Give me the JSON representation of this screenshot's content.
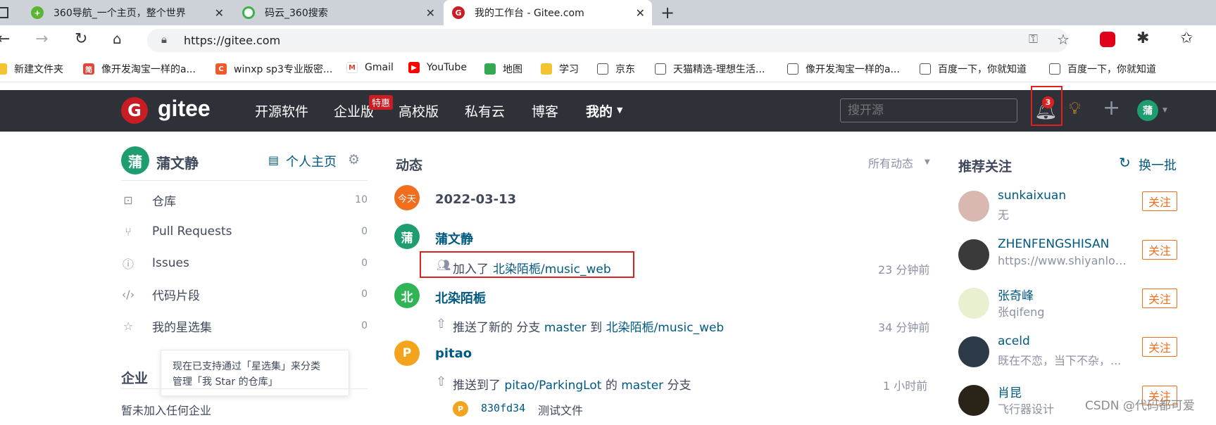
{
  "browser": {
    "tabs": [
      {
        "title": "360导航_一个主页，整个世界",
        "icon": "360-plus-icon"
      },
      {
        "title": "码云_360搜索",
        "icon": "360-search-icon"
      },
      {
        "title": "我的工作台 - Gitee.com",
        "icon": "gitee-icon"
      }
    ],
    "new_tab": "+",
    "url": "https://gitee.com",
    "bookmarks": [
      {
        "label": "新建文件夹",
        "icon": "folder-icon"
      },
      {
        "label": "像开发淘宝一样的a...",
        "icon": "jian-icon"
      },
      {
        "label": "winxp sp3专业版密...",
        "icon": "c-icon"
      },
      {
        "label": "Gmail",
        "icon": "gmail-icon"
      },
      {
        "label": "YouTube",
        "icon": "youtube-icon"
      },
      {
        "label": "地图",
        "icon": "maps-icon"
      },
      {
        "label": "学习",
        "icon": "folder-icon"
      },
      {
        "label": "京东",
        "icon": "page-icon"
      },
      {
        "label": "天猫精选-理想生活...",
        "icon": "page-icon"
      },
      {
        "label": "像开发淘宝一样的a...",
        "icon": "page-icon"
      },
      {
        "label": "百度一下，你就知道",
        "icon": "page-icon"
      },
      {
        "label": "百度一下，你就知道",
        "icon": "page-icon"
      }
    ]
  },
  "header": {
    "logo": "gitee",
    "nav": [
      "开源软件",
      "企业版",
      "高校版",
      "私有云",
      "博客",
      "我的"
    ],
    "enterprise_badge": "特惠",
    "search_placeholder": "搜开源",
    "notification_count": "3",
    "avatar_char": "蒲"
  },
  "sidebar": {
    "user_name": "蒲文静",
    "avatar_char": "蒲",
    "home_link": "个人主页",
    "items": [
      {
        "label": "仓库",
        "count": "10",
        "icon": "repo-icon"
      },
      {
        "label": "Pull Requests",
        "count": "0",
        "icon": "pull-request-icon"
      },
      {
        "label": "Issues",
        "count": "0",
        "icon": "issue-icon"
      },
      {
        "label": "代码片段",
        "count": "0",
        "icon": "code-snippet-icon"
      },
      {
        "label": "我的星选集",
        "count": "0",
        "icon": "star-icon"
      }
    ],
    "tooltip_line1": "现在已支持通过「星选集」来分类",
    "tooltip_line2": "管理「我 Star 的仓库」",
    "enterprise_title": "企业",
    "enterprise_empty": "暂未加入任何企业"
  },
  "feed": {
    "title": "动态",
    "filter": "所有动态",
    "today_badge": "今天",
    "date": "2022-03-13",
    "events": [
      {
        "user": "蒲文静",
        "avatar_char": "蒲",
        "avatar_color": "#1e9d6f",
        "action": "加入了",
        "repo": "北染陌栀/music_web",
        "time": "23 分钟前"
      },
      {
        "user": "北染陌栀",
        "avatar_char": "北",
        "avatar_color": "#30b455",
        "action": "推送了新的 分支",
        "branch": "master",
        "to": "到",
        "repo": "北染陌栀/music_web",
        "time": "34 分钟前"
      },
      {
        "user": "pitao",
        "avatar_char": "P",
        "avatar_color": "#f3a31c",
        "action": "推送到了",
        "repo": "pitao/ParkingLot",
        "of": "的",
        "branch": "master",
        "suffix": "分支",
        "time": "1 小时前",
        "commit_hash": "830fd34",
        "commit_msg": "测试文件"
      }
    ]
  },
  "recommend": {
    "title": "推荐关注",
    "refresh": "换一批",
    "follow_label": "关注",
    "users": [
      {
        "name": "sunkaixuan",
        "desc": "无"
      },
      {
        "name": "ZHENFENGSHISAN",
        "desc": "https://www.shiyanlou...."
      },
      {
        "name": "张奇峰",
        "desc": "张qifeng"
      },
      {
        "name": "aceld",
        "desc": "既在不恋，当下不杂，..."
      },
      {
        "name": "肖昆",
        "desc": "飞行器设计"
      }
    ]
  },
  "watermark": "CSDN @代码都可爱"
}
